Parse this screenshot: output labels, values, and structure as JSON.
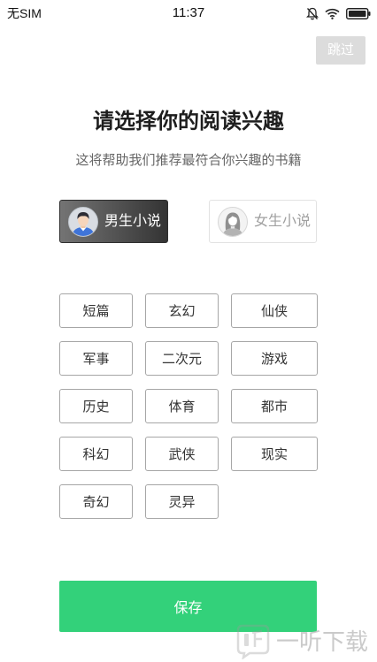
{
  "status_bar": {
    "carrier": "无SIM",
    "time": "11:37",
    "icons": [
      "mute-bell-icon",
      "wifi-icon",
      "battery-icon"
    ]
  },
  "skip_button": {
    "label": "跳过"
  },
  "header": {
    "title": "请选择你的阅读兴趣",
    "subtitle": "这将帮助我们推荐最符合你兴趣的书籍"
  },
  "gender_options": [
    {
      "label": "男生小说",
      "icon": "male-avatar-icon",
      "selected": true
    },
    {
      "label": "女生小说",
      "icon": "female-avatar-icon",
      "selected": false
    }
  ],
  "tags": [
    "短篇",
    "玄幻",
    "仙侠",
    "军事",
    "二次元",
    "游戏",
    "历史",
    "体育",
    "都市",
    "科幻",
    "武侠",
    "现实",
    "奇幻",
    "灵异"
  ],
  "save_button": {
    "label": "保存"
  },
  "watermark": {
    "text": "一听下载",
    "icon": "watermark-logo-icon"
  },
  "colors": {
    "accent": "#33d17a",
    "selected_option": "#3c3c3c",
    "skip_button": "#dcdcdc",
    "tag_border": "#a6a6a6"
  }
}
